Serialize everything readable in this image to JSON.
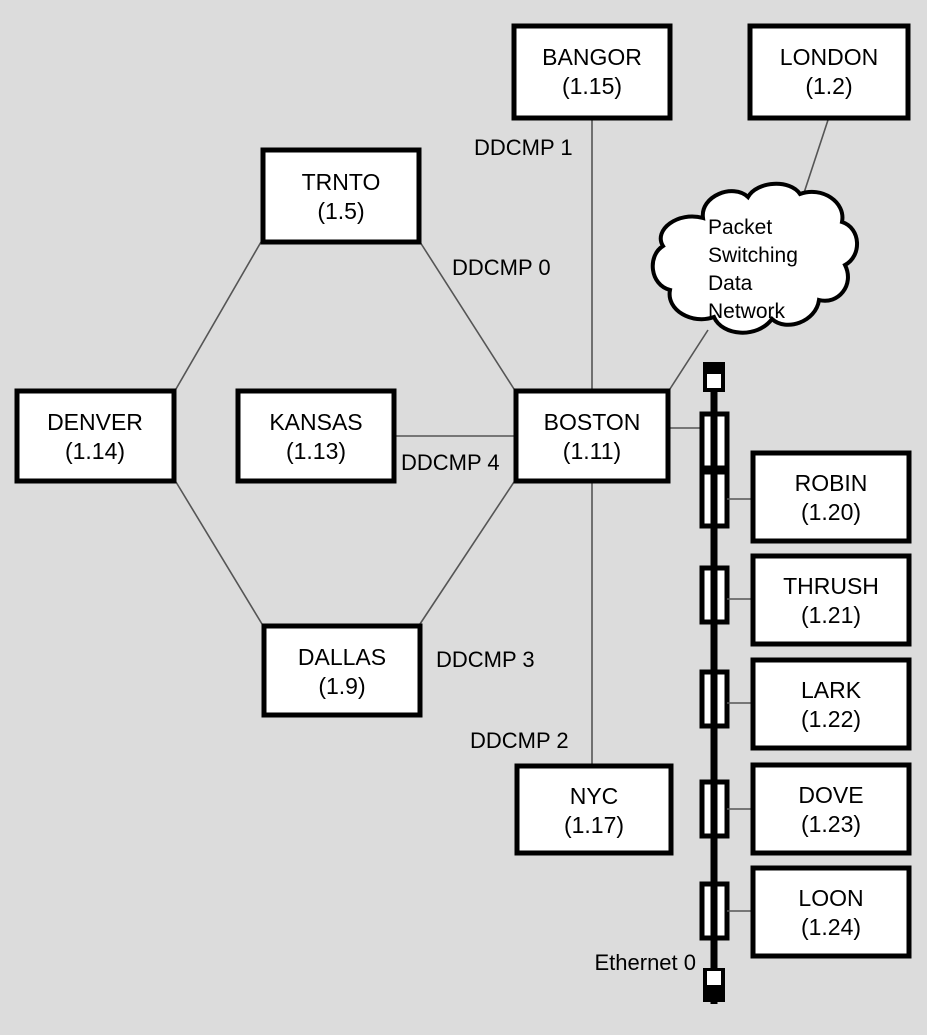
{
  "diagram": {
    "title": "DECnet network topology diagram",
    "background_color": "#dcdcdc",
    "box_fill_color": "#ffffff",
    "box_border_color": "#000000",
    "line_color": "#555555",
    "bus_color": "#000000"
  },
  "nodes": {
    "bangor": {
      "name": "BANGOR",
      "address": "(1.15)"
    },
    "london": {
      "name": "LONDON",
      "address": "(1.2)"
    },
    "trnto": {
      "name": "TRNTO",
      "address": "(1.5)"
    },
    "denver": {
      "name": "DENVER",
      "address": "(1.14)"
    },
    "kansas": {
      "name": "KANSAS",
      "address": "(1.13)"
    },
    "boston": {
      "name": "BOSTON",
      "address": "(1.11)"
    },
    "dallas": {
      "name": "DALLAS",
      "address": "(1.9)"
    },
    "nyc": {
      "name": "NYC",
      "address": "(1.17)"
    },
    "robin": {
      "name": "ROBIN",
      "address": "(1.20)"
    },
    "thrush": {
      "name": "THRUSH",
      "address": "(1.21)"
    },
    "lark": {
      "name": "LARK",
      "address": "(1.22)"
    },
    "dove": {
      "name": "DOVE",
      "address": "(1.23)"
    },
    "loon": {
      "name": "LOON",
      "address": "(1.24)"
    }
  },
  "cloud": {
    "line1": "Packet",
    "line2": "Switching",
    "line3": "Data",
    "line4": "Network"
  },
  "links": {
    "ddcmp0": "DDCMP 0",
    "ddcmp1": "DDCMP 1",
    "ddcmp2": "DDCMP 2",
    "ddcmp3": "DDCMP 3",
    "ddcmp4": "DDCMP 4",
    "ethernet0": "Ethernet 0"
  }
}
